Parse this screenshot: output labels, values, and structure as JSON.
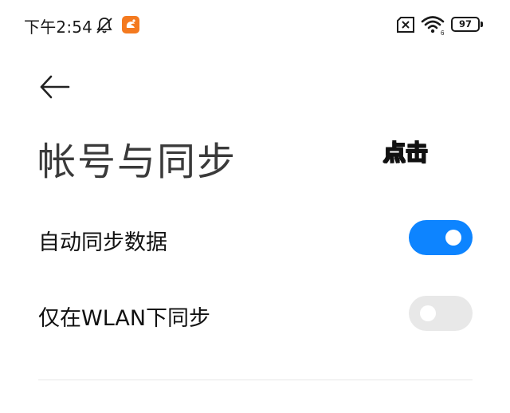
{
  "status_bar": {
    "time": "下午2:54",
    "battery_level": "97",
    "icons": [
      "mute-icon",
      "app-icon",
      "no-sim-icon",
      "wifi-icon",
      "battery-icon"
    ]
  },
  "page": {
    "title": "帐号与同步",
    "annotation": "点击"
  },
  "settings": [
    {
      "label": "自动同步数据",
      "enabled": true
    },
    {
      "label": "仅在WLAN下同步",
      "enabled": false
    }
  ],
  "colors": {
    "accent": "#0d84ff",
    "toggle_off": "#e8e8e8",
    "annotation": "#ffd400",
    "app_icon": "#f47a1f"
  }
}
